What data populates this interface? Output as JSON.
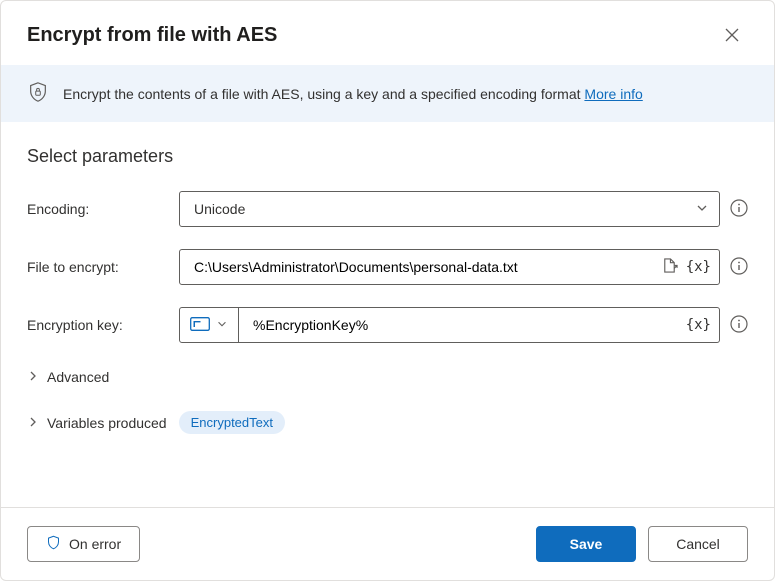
{
  "header": {
    "title": "Encrypt from file with AES"
  },
  "banner": {
    "text": "Encrypt the contents of a file with AES, using a key and a specified encoding format ",
    "more_info": "More info"
  },
  "section": {
    "title": "Select parameters"
  },
  "fields": {
    "encoding": {
      "label": "Encoding:",
      "value": "Unicode"
    },
    "file": {
      "label": "File to encrypt:",
      "value": "C:\\Users\\Administrator\\Documents\\personal-data.txt"
    },
    "key": {
      "label": "Encryption key:",
      "value": "%EncryptionKey%"
    }
  },
  "expandable": {
    "advanced": "Advanced",
    "variables_produced": "Variables produced",
    "variable_chip": "EncryptedText"
  },
  "footer": {
    "on_error": "On error",
    "save": "Save",
    "cancel": "Cancel"
  }
}
